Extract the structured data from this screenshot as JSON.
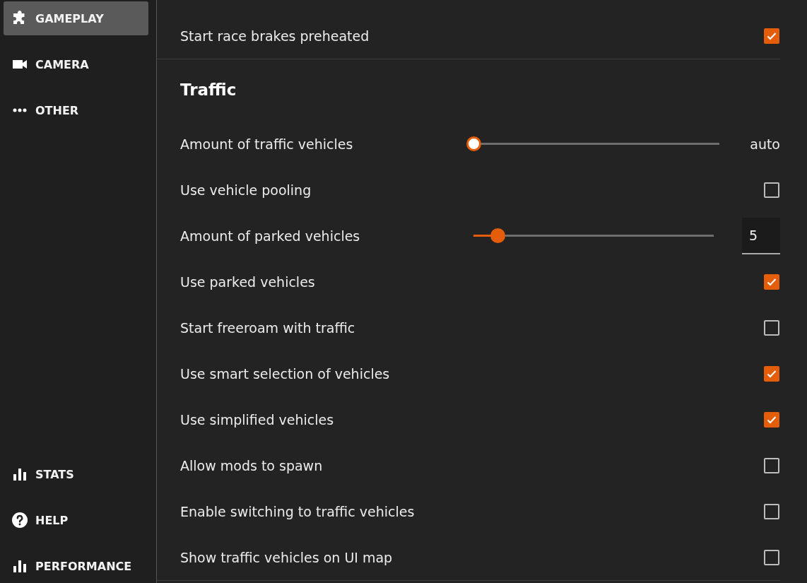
{
  "sidebar": {
    "top_items": [
      {
        "label": "GAMEPLAY",
        "selected": true
      },
      {
        "label": "CAMERA",
        "selected": false
      },
      {
        "label": "OTHER",
        "selected": false
      }
    ],
    "bottom_items": [
      {
        "label": "STATS",
        "selected": false
      },
      {
        "label": "HELP",
        "selected": false
      },
      {
        "label": "PERFORMANCE",
        "selected": false
      }
    ]
  },
  "sections": [
    {
      "rows": [
        {
          "kind": "checkbox",
          "label": "Start race brakes preheated",
          "checked": true
        }
      ]
    },
    {
      "title": "Traffic",
      "rows": [
        {
          "kind": "slider",
          "label": "Amount of traffic vehicles",
          "level": 0,
          "auto": true,
          "reading": "auto"
        },
        {
          "kind": "checkbox",
          "label": "Use vehicle pooling",
          "checked": false
        },
        {
          "kind": "slider-input",
          "label": "Amount of parked vehicles",
          "level": 0.1,
          "auto": false,
          "value": "5"
        },
        {
          "kind": "checkbox",
          "label": "Use parked vehicles",
          "checked": true
        },
        {
          "kind": "checkbox",
          "label": "Start freeroam with traffic",
          "checked": false
        },
        {
          "kind": "checkbox",
          "label": "Use smart selection of vehicles",
          "checked": true
        },
        {
          "kind": "checkbox",
          "label": "Use simplified vehicles",
          "checked": true
        },
        {
          "kind": "checkbox",
          "label": "Allow mods to spawn",
          "checked": false
        },
        {
          "kind": "checkbox",
          "label": "Enable switching to traffic vehicles",
          "checked": false
        },
        {
          "kind": "checkbox",
          "label": "Show traffic vehicles on UI map",
          "checked": false
        }
      ]
    }
  ]
}
